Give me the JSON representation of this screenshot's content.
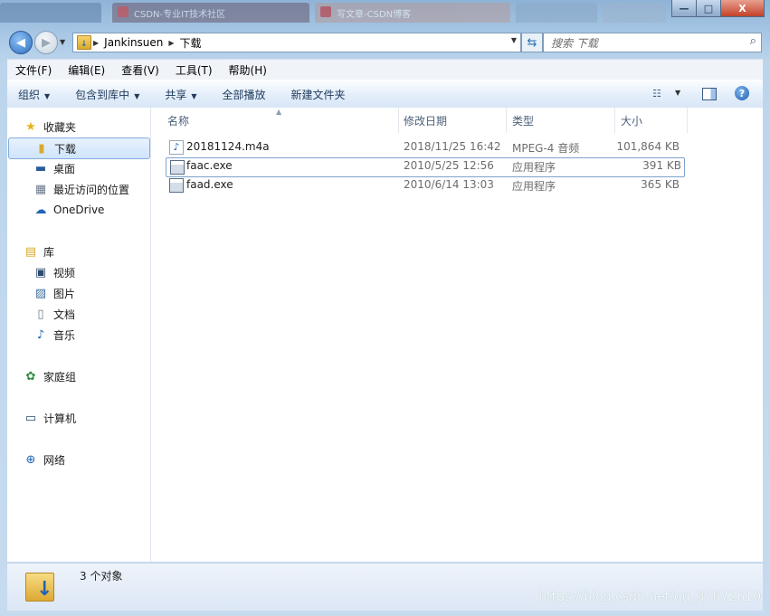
{
  "window": {
    "tabs": [
      {
        "label": "CSDN-专业IT技术社区"
      },
      {
        "label": "写文章-CSDN博客"
      }
    ],
    "controls": {
      "minimize": "—",
      "maximize": "□",
      "close": "X"
    }
  },
  "address": {
    "crumbs": [
      "Jankinsuen",
      "下载"
    ],
    "search_placeholder": "搜索 下载"
  },
  "menubar": {
    "items": [
      "文件(F)",
      "编辑(E)",
      "查看(V)",
      "工具(T)",
      "帮助(H)"
    ]
  },
  "commandbar": {
    "items": [
      "组织",
      "包含到库中",
      "共享",
      "全部播放",
      "新建文件夹"
    ]
  },
  "navpane": {
    "favorites": {
      "label": "收藏夹",
      "items": [
        "下载",
        "桌面",
        "最近访问的位置",
        "OneDrive"
      ]
    },
    "library": {
      "label": "库",
      "items": [
        "视频",
        "图片",
        "文档",
        "音乐"
      ]
    },
    "homegroup": "家庭组",
    "computer": "计算机",
    "network": "网络"
  },
  "filelist": {
    "columns": [
      "名称",
      "修改日期",
      "类型",
      "大小"
    ],
    "rows": [
      {
        "name": "20181124.m4a",
        "date": "2018/11/25 16:42",
        "type": "MPEG-4 音频",
        "size": "101,864 KB",
        "icon": "music-file-icon"
      },
      {
        "name": "faac.exe",
        "date": "2010/5/25 12:56",
        "type": "应用程序",
        "size": "391 KB",
        "icon": "exe-file-icon"
      },
      {
        "name": "faad.exe",
        "date": "2010/6/14 13:03",
        "type": "应用程序",
        "size": "365 KB",
        "icon": "exe-file-icon"
      }
    ]
  },
  "status": {
    "count": "3 个对象"
  },
  "watermark": "https://blog.csdn.net/qq_37672610"
}
